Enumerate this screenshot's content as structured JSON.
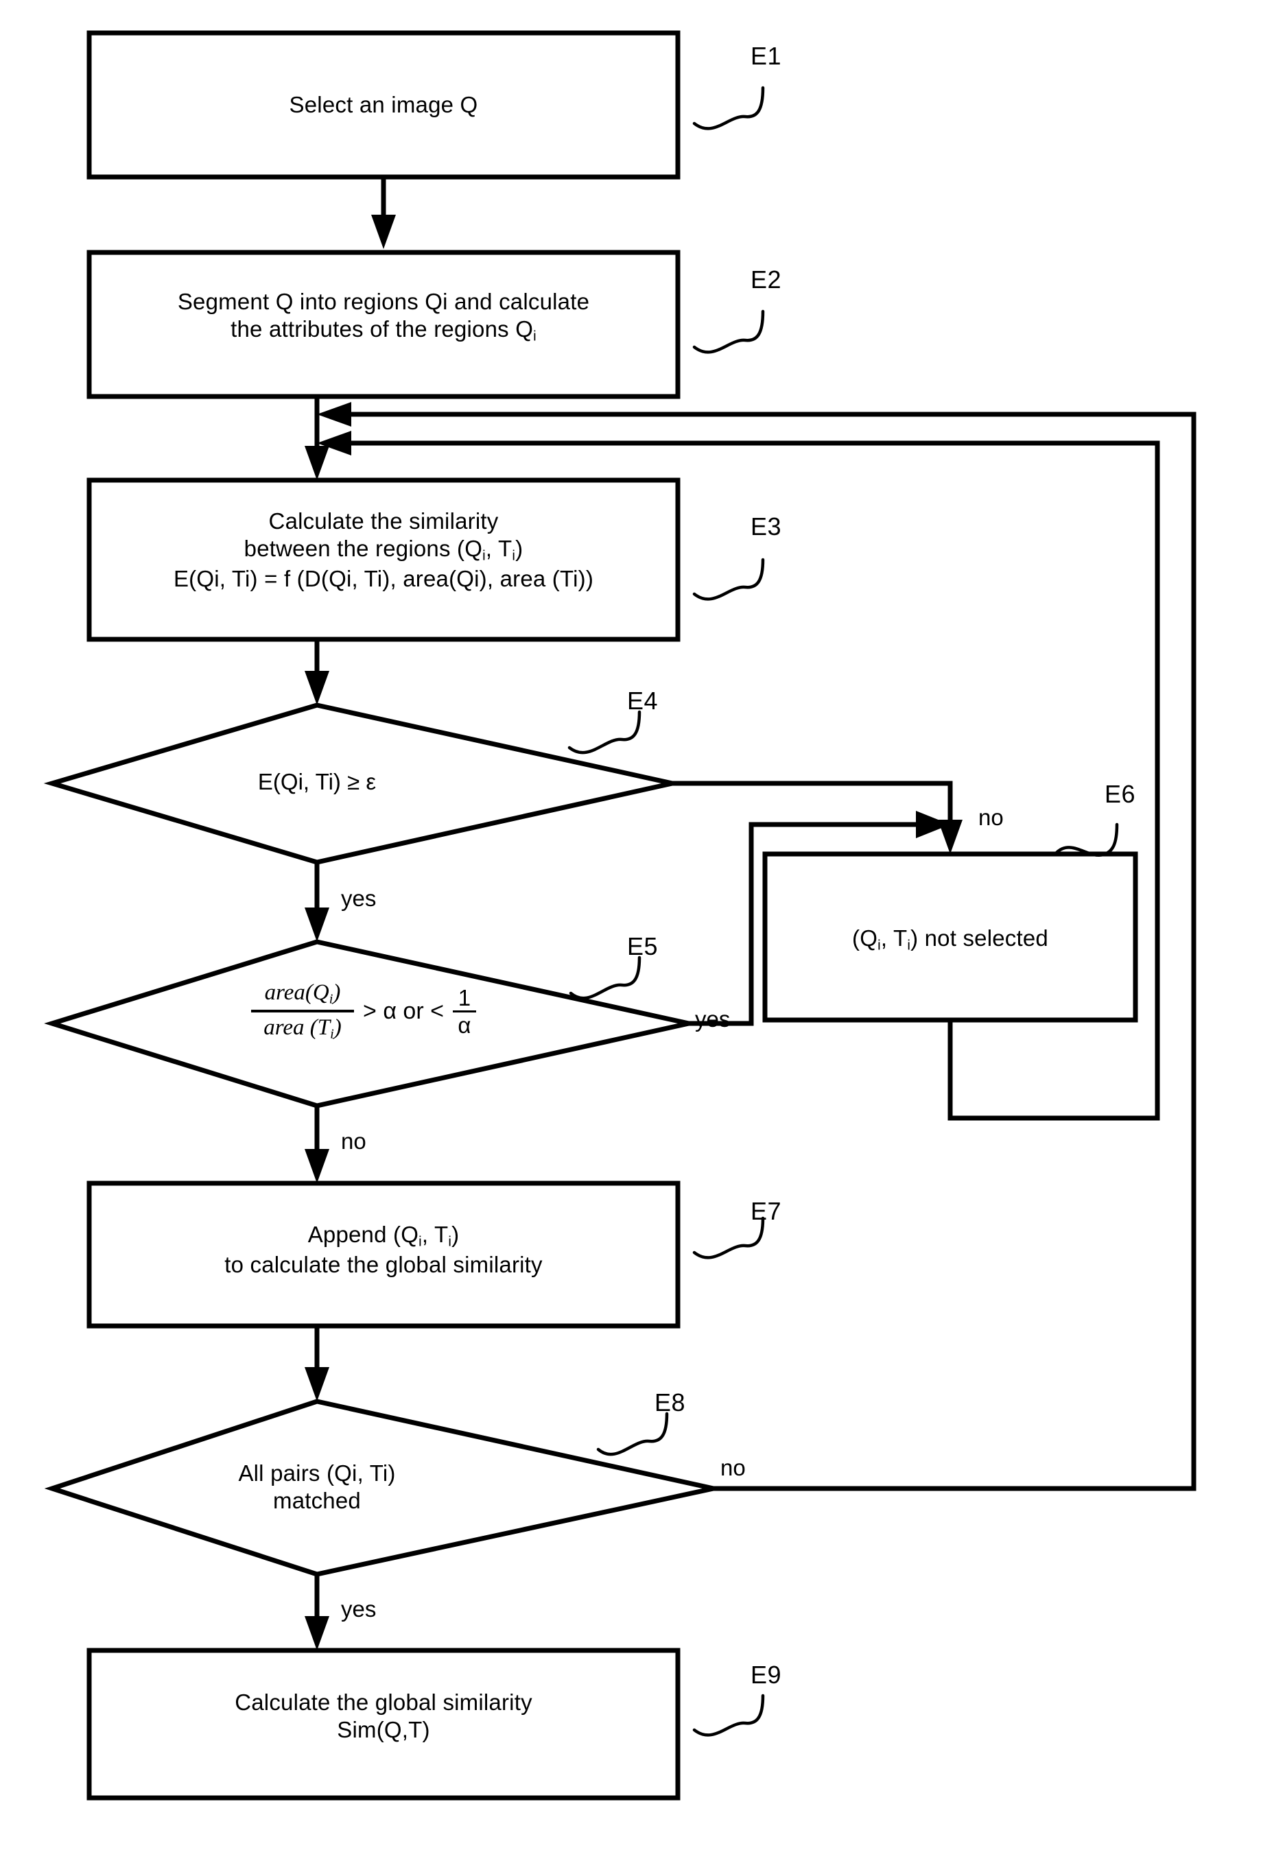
{
  "diagram": {
    "type": "flowchart",
    "title": "Image region matching similarity flowchart",
    "nodes": [
      {
        "ref": "E1",
        "kind": "process",
        "lines": [
          "Select an image  Q"
        ]
      },
      {
        "ref": "E2",
        "kind": "process",
        "lines": [
          "Segment Q into regions Qi and calculate",
          "the attributes of the regions Q"
        ],
        "sub_last": "i"
      },
      {
        "ref": "E3",
        "kind": "process",
        "lines": [
          "Calculate the similarity",
          "between the  regions (Q",
          "E(Qi, Ti) = f (D(Qi, Ti), area(Qi), area (Ti))"
        ],
        "line2_full": "between the  regions (Qi, Ti)"
      },
      {
        "ref": "E4",
        "kind": "decision",
        "lines": [
          "E(Qi, Ti) ≥ ε"
        ],
        "branch_yes": "yes",
        "branch_no": "no"
      },
      {
        "ref": "E5",
        "kind": "decision",
        "formula": {
          "numerator": "area(Q",
          "numerator_sub": "i",
          "numerator_tail": ")",
          "denominator": "area (T",
          "denominator_sub": "i",
          "denominator_tail": ")",
          "operator": "> α  or  <",
          "small_fraction_num": "1",
          "small_fraction_den": "α"
        },
        "branch_yes": "yes",
        "branch_no": "no"
      },
      {
        "ref": "E6",
        "kind": "process",
        "lines": [
          "(Q",
          "T",
          ") not selected"
        ],
        "full_text": "(Qi, Ti) not selected"
      },
      {
        "ref": "E7",
        "kind": "process",
        "lines": [
          "Append (Q",
          "to calculate the global similarity"
        ],
        "line1_full": "Append (Qi, Ti)"
      },
      {
        "ref": "E8",
        "kind": "decision",
        "lines": [
          "All pairs (Qi, Ti)",
          "matched"
        ],
        "branch_yes": "yes",
        "branch_no": "no"
      },
      {
        "ref": "E9",
        "kind": "process",
        "lines": [
          "Calculate the global similarity",
          "Sim(Q,T)"
        ]
      }
    ],
    "edge_labels": {
      "e4_no": "no",
      "e4_yes": "yes",
      "e5_yes": "yes",
      "e5_no": "no",
      "e8_no": "no",
      "e8_yes": "yes"
    },
    "refs": {
      "e1": "E1",
      "e2": "E2",
      "e3": "E3",
      "e4": "E4",
      "e5": "E5",
      "e6": "E6",
      "e7": "E7",
      "e8": "E8",
      "e9": "E9"
    },
    "text": {
      "e1_line1": "Select an image  Q",
      "e2_line1": "Segment Q into regions Qi and calculate",
      "e2_line2_a": "the attributes of the regions Q",
      "e2_line2_sub": "i",
      "e3_line1": "Calculate the similarity",
      "e3_line2_a": "between the  regions (Q",
      "e3_line2_sub1": "i",
      "e3_line2_b": ", T",
      "e3_line2_sub2": "i",
      "e3_line2_c": ")",
      "e3_line3": "E(Qi, Ti) = f (D(Qi, Ti), area(Qi), area (Ti))",
      "e4_cond": "E(Qi, Ti) ≥ ε",
      "e5_num": "area(Q",
      "e5_num_sub": "i",
      "e5_num_end": ")",
      "e5_den": "area (T",
      "e5_den_sub": "i",
      "e5_den_end": ")",
      "e5_op1": "> α  or  <",
      "e5_frac_num": "1",
      "e5_frac_den": "α",
      "e6_a": "(Q",
      "e6_sub1": "i",
      "e6_b": ", T",
      "e6_sub2": "i",
      "e6_c": ") not selected",
      "e7_a": "Append (Q",
      "e7_sub1": "i",
      "e7_b": ", T",
      "e7_sub2": "i",
      "e7_c": ")",
      "e7_line2": "to calculate the global similarity",
      "e8_line1": "All pairs (Qi, Ti)",
      "e8_line2": "matched",
      "e9_line1": "Calculate the global similarity",
      "e9_line2": "Sim(Q,T)"
    },
    "colors": {
      "stroke": "#000000",
      "fill": "#ffffff"
    }
  }
}
